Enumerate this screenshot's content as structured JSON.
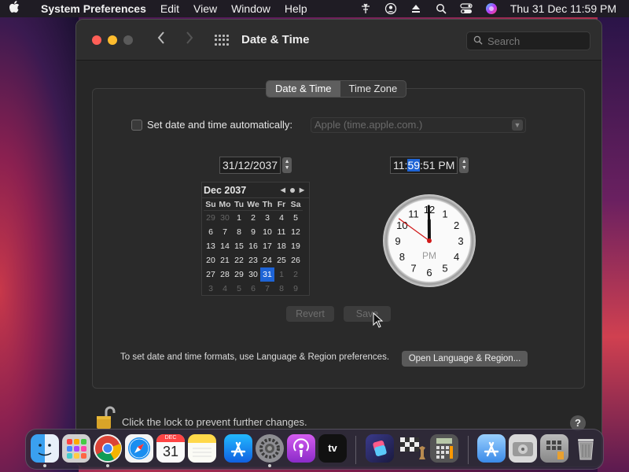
{
  "menubar": {
    "app_name": "System Preferences",
    "menus": [
      "Edit",
      "View",
      "Window",
      "Help"
    ],
    "clock": "Thu 31 Dec  11:59 PM"
  },
  "window": {
    "title": "Date & Time",
    "search_placeholder": "Search"
  },
  "tabs": [
    "Date & Time",
    "Time Zone"
  ],
  "auto": {
    "label": "Set date and time automatically:",
    "checked": false,
    "server": "Apple (time.apple.com.)"
  },
  "date": {
    "value": "31/12/2037"
  },
  "time": {
    "hh": "11",
    "mm": "59",
    "ss_ampm": "51 PM"
  },
  "calendar": {
    "month_label": "Dec 2037",
    "weekdays": [
      "Su",
      "Mo",
      "Tu",
      "We",
      "Th",
      "Fr",
      "Sa"
    ],
    "weeks": [
      [
        "29",
        "30",
        "1",
        "2",
        "3",
        "4",
        "5"
      ],
      [
        "6",
        "7",
        "8",
        "9",
        "10",
        "11",
        "12"
      ],
      [
        "13",
        "14",
        "15",
        "16",
        "17",
        "18",
        "19"
      ],
      [
        "20",
        "21",
        "22",
        "23",
        "24",
        "25",
        "26"
      ],
      [
        "27",
        "28",
        "29",
        "30",
        "31",
        "1",
        "2"
      ],
      [
        "3",
        "4",
        "5",
        "6",
        "7",
        "8",
        "9"
      ]
    ],
    "selected": "31"
  },
  "clock": {
    "numerals": [
      "12",
      "1",
      "2",
      "3",
      "4",
      "5",
      "6",
      "7",
      "8",
      "9",
      "10",
      "11"
    ],
    "ampm": "PM",
    "hours": 11,
    "minutes": 59,
    "seconds": 51
  },
  "buttons": {
    "revert": "Revert",
    "save": "Save",
    "open_language": "Open Language & Region..."
  },
  "formats_text": "To set date and time formats, use Language & Region preferences.",
  "lock_text": "Click the lock to prevent further changes.",
  "help": "?",
  "dock": {
    "calendar_month": "DEC",
    "calendar_day": "31",
    "tv_label": "tv",
    "apps": [
      "Finder",
      "Launchpad",
      "Chrome",
      "Safari",
      "Calendar",
      "Notes",
      "App Store",
      "System Preferences",
      "Podcasts",
      "TV",
      "Shortcuts",
      "Chess",
      "Calculator",
      "App Store Folder",
      "Disk Utility",
      "Keychain",
      "Trash"
    ]
  },
  "colors": {
    "accent": "#1e64d6",
    "close": "#ff5f57",
    "minimize": "#febc2e"
  }
}
